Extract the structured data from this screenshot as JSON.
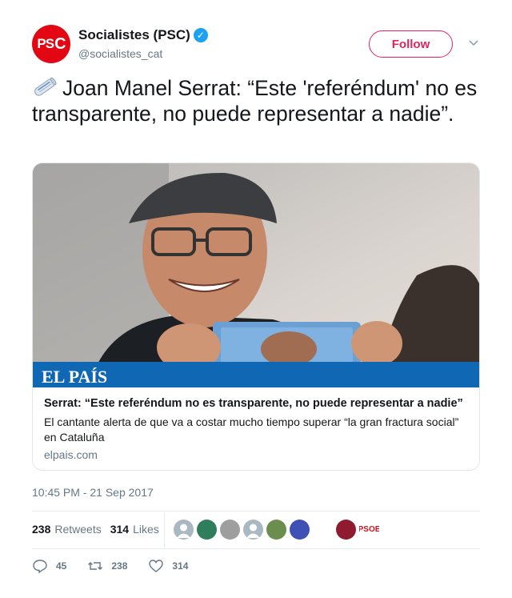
{
  "author": {
    "avatar_text_main": "PS",
    "avatar_text_accent": "C",
    "name": "Socialistes (PSC)",
    "handle": "@socialistes_cat",
    "verified_icon": "verified-badge-icon"
  },
  "follow_label": "Follow",
  "tweet_text": "Joan Manel Serrat: “Este 'referéndum' no es transparente, no puede representar a nadie”.",
  "card": {
    "brand": "EL PAÍS",
    "title": "Serrat: “Este referéndum no es transparente, no puede representar a nadie”",
    "description": "El cantante alerta de que va a costar mucho tiempo superar “la gran fractura social” en Cataluña",
    "domain": "elpais.com"
  },
  "timestamp": "10:45 PM - 21 Sep 2017",
  "stats": {
    "retweets_count": "238",
    "retweets_label": "Retweets",
    "likes_count": "314",
    "likes_label": "Likes"
  },
  "likers": [
    {
      "label": "",
      "color": "#aab8c2"
    },
    {
      "label": "",
      "color": "#2e7d5b"
    },
    {
      "label": "",
      "color": "#9e9e9e"
    },
    {
      "label": "",
      "color": "#aab8c2"
    },
    {
      "label": "",
      "color": "#6b8e4e"
    },
    {
      "label": "",
      "color": "#3f51b5"
    },
    {
      "label": "",
      "color": "#ffffff"
    },
    {
      "label": "",
      "color": "#8e1b2f"
    },
    {
      "label": "PSOE",
      "color": "#ffffff"
    }
  ],
  "actions": {
    "reply_count": "45",
    "retweet_count": "238",
    "like_count": "314"
  },
  "colors": {
    "follow": "#e0245e",
    "verified": "#1da1f2",
    "elpais_bar": "#1068b4",
    "avatar_bg": "#e30613"
  }
}
